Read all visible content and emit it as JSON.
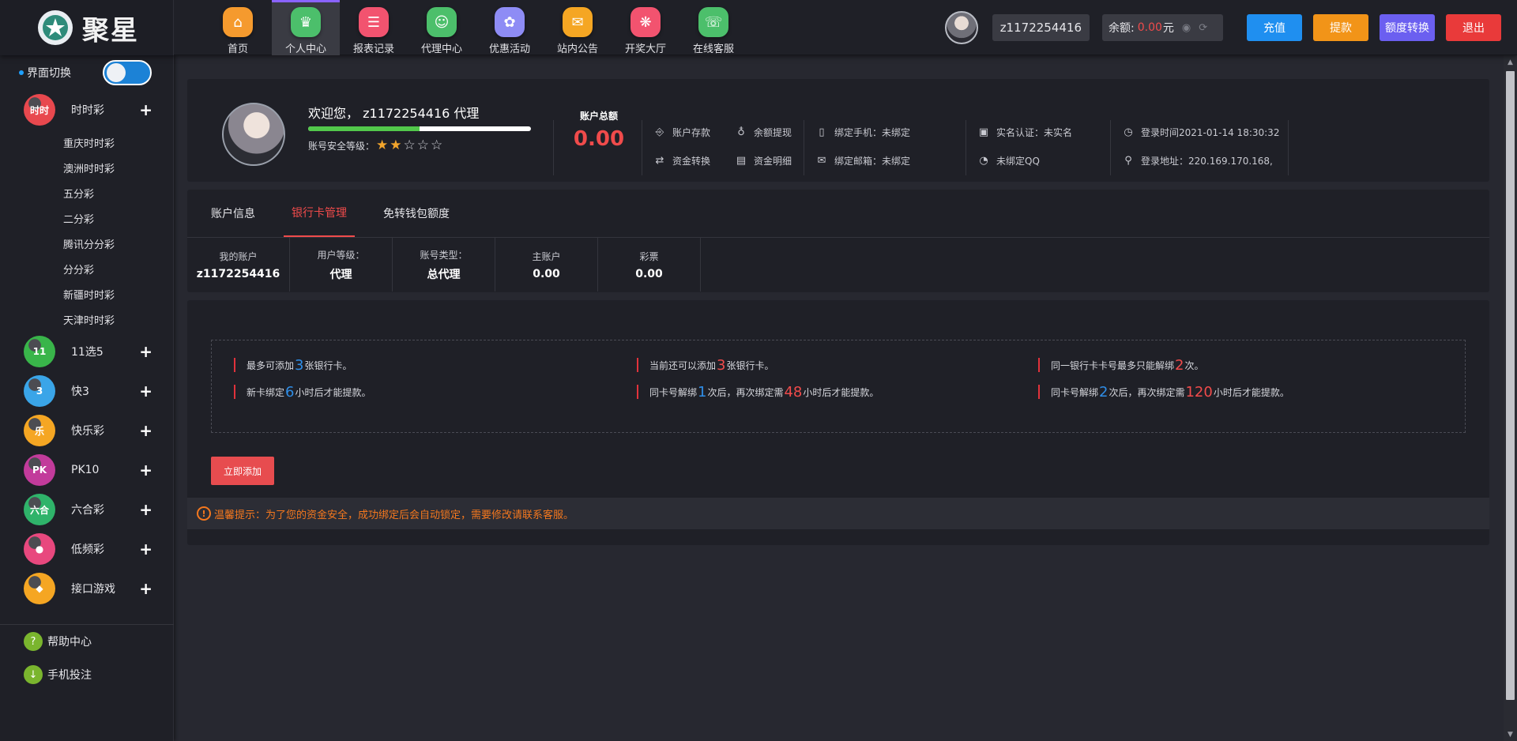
{
  "brand": {
    "name": "聚星"
  },
  "nav": [
    {
      "label": "首页",
      "icon": "home-icon",
      "color": "#f59a2e",
      "glyph": "⌂"
    },
    {
      "label": "个人中心",
      "icon": "crown-icon",
      "color": "#4cbf6b",
      "glyph": "♛",
      "active": true
    },
    {
      "label": "报表记录",
      "icon": "report-icon",
      "color": "#f2536f",
      "glyph": "☰"
    },
    {
      "label": "代理中心",
      "icon": "agent-icon",
      "color": "#4cbf6b",
      "glyph": "☺"
    },
    {
      "label": "优惠活动",
      "icon": "promo-icon",
      "color": "#8e8cf5",
      "glyph": "✿"
    },
    {
      "label": "站内公告",
      "icon": "mail-icon",
      "color": "#f5a623",
      "glyph": "✉"
    },
    {
      "label": "开奖大厅",
      "icon": "lottery-icon",
      "color": "#f2536f",
      "glyph": "❋"
    },
    {
      "label": "在线客服",
      "icon": "support-icon",
      "color": "#4cbf6b",
      "glyph": "☏"
    }
  ],
  "header": {
    "username": "z1172254416",
    "balance_label": "余额:",
    "balance_value": "0.00",
    "balance_unit": "元",
    "buttons": [
      {
        "label": "充值",
        "color": "#1f8ff0"
      },
      {
        "label": "提款",
        "color": "#f29418"
      },
      {
        "label": "额度转换",
        "color": "#6b5ff0"
      },
      {
        "label": "退出",
        "color": "#e93a3a"
      }
    ]
  },
  "sidebar": {
    "switch_label": "界面切换",
    "categories": [
      {
        "label": "时时彩",
        "icon": "ssc-icon",
        "badge": "时时",
        "color": "#e8484e",
        "expanded": true,
        "children": [
          "重庆时时彩",
          "澳洲时时彩",
          "五分彩",
          "二分彩",
          "腾讯分分彩",
          "分分彩",
          "新疆时时彩",
          "天津时时彩"
        ]
      },
      {
        "label": "11选5",
        "icon": "11x5-icon",
        "badge": "11",
        "color": "#39b54a"
      },
      {
        "label": "快3",
        "icon": "k3-icon",
        "badge": "3",
        "color": "#3aa5e8"
      },
      {
        "label": "快乐彩",
        "icon": "happy-icon",
        "badge": "乐",
        "color": "#f5a623"
      },
      {
        "label": "PK10",
        "icon": "pk10-icon",
        "badge": "PK",
        "color": "#c23b9b"
      },
      {
        "label": "六合彩",
        "icon": "mark6-icon",
        "badge": "六合",
        "color": "#2fb36a"
      },
      {
        "label": "低频彩",
        "icon": "lowfreq-icon",
        "badge": "●",
        "color": "#e8487e"
      },
      {
        "label": "接口游戏",
        "icon": "api-game-icon",
        "badge": "◆",
        "color": "#f5a623"
      }
    ],
    "footer": [
      {
        "label": "帮助中心",
        "icon": "help-icon",
        "glyph": "?"
      },
      {
        "label": "手机投注",
        "icon": "download-icon",
        "glyph": "↓"
      }
    ]
  },
  "profile": {
    "welcome_prefix": "欢迎您，",
    "username": "z1172254416",
    "role": "代理",
    "progress_percent": 50,
    "security_label": "账号安全等级：",
    "stars_total": 5,
    "stars_filled": 2,
    "total_label": "账户总额",
    "total_value": "0.00",
    "actions": [
      {
        "label": "账户存款",
        "icon": "deposit-icon",
        "glyph": "⎆"
      },
      {
        "label": "余额提现",
        "icon": "withdraw-icon",
        "glyph": "♁"
      },
      {
        "label": "资金转换",
        "icon": "transfer-icon",
        "glyph": "⇄"
      },
      {
        "label": "资金明细",
        "icon": "detail-icon",
        "glyph": "▤"
      }
    ],
    "bindings": [
      {
        "label": "绑定手机：未绑定",
        "icon": "phone-icon",
        "glyph": "▯"
      },
      {
        "label": "绑定邮箱：未绑定",
        "icon": "email-icon",
        "glyph": "✉"
      },
      {
        "label": "实名认证：未实名",
        "icon": "id-card-icon",
        "glyph": "▣"
      },
      {
        "label": "未绑定QQ",
        "icon": "qq-icon",
        "glyph": "◔"
      }
    ],
    "login_time": "登录时间2021-01-14 18:30:32",
    "login_addr": "登录地址：220.169.170.168,"
  },
  "tabs": [
    {
      "label": "账户信息",
      "active": false
    },
    {
      "label": "银行卡管理",
      "active": true
    },
    {
      "label": "免转钱包额度",
      "active": false
    }
  ],
  "account_cells": [
    {
      "key": "我的账户",
      "value": "z1172254416"
    },
    {
      "key": "用户等级：",
      "value": "代理"
    },
    {
      "key": "账号类型：",
      "value": "总代理"
    },
    {
      "key": "主账户",
      "value": "0.00"
    },
    {
      "key": "彩票",
      "value": "0.00"
    }
  ],
  "bank_rules": [
    {
      "pre": "最多可添加",
      "num": "3",
      "color": "blue",
      "post": "张银行卡。"
    },
    {
      "pre": "当前还可以添加",
      "num": "3",
      "color": "red",
      "post": "张银行卡。"
    },
    {
      "pre": "同一银行卡卡号最多只能解绑",
      "num": "2",
      "color": "red",
      "post": "次。"
    },
    {
      "pre": "新卡绑定",
      "num": "6",
      "color": "blue",
      "post": "小时后才能提款。"
    },
    {
      "pre": "同卡号解绑",
      "num": "1",
      "color": "blue",
      "mid": "次后，再次绑定需",
      "num2": "48",
      "color2": "red",
      "post": "小时后才能提款。"
    },
    {
      "pre": "同卡号解绑",
      "num": "2",
      "color": "blue",
      "mid": "次后，再次绑定需",
      "num2": "120",
      "color2": "red",
      "post": "小时后才能提款。"
    }
  ],
  "add_button": "立即添加",
  "tip": "温馨提示：为了您的资金安全，成功绑定后会自动锁定，需要修改请联系客服。"
}
